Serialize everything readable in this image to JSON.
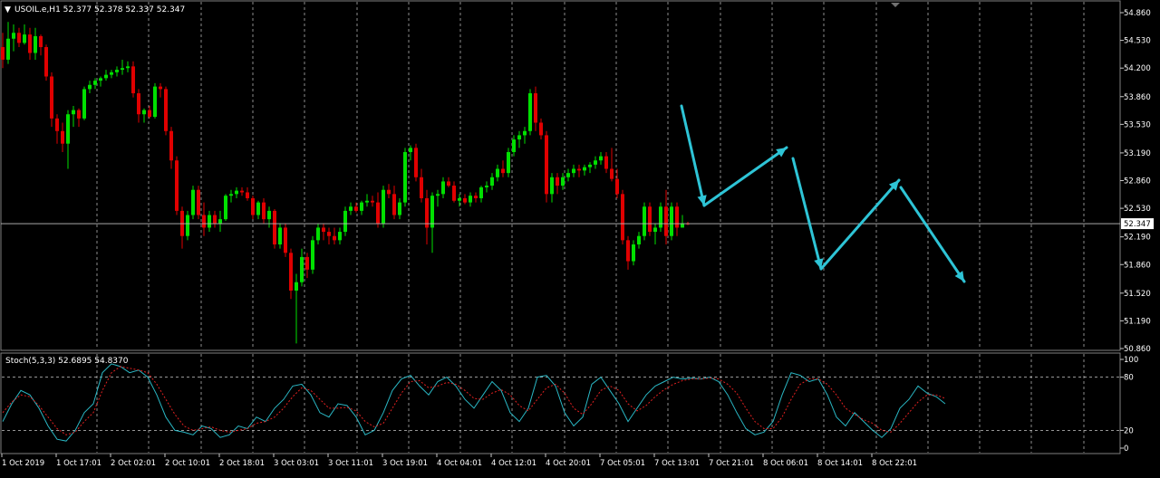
{
  "window": {
    "symbol_line": "USOIL.e,H1  52.377 52.378 52.337 52.347",
    "menu_marker": "▼"
  },
  "price_panel": {
    "current_price_label": "52.347",
    "price_ticks": [
      "54.860",
      "54.530",
      "54.200",
      "53.860",
      "53.530",
      "53.190",
      "52.860",
      "52.530",
      "52.190",
      "51.860",
      "51.520",
      "51.190",
      "50.860"
    ]
  },
  "stoch_panel": {
    "label": "Stoch(5,3,3) 52.6895 54.8370",
    "level_ticks": [
      "100",
      "80",
      "20",
      "0"
    ]
  },
  "time_axis": {
    "labels": [
      "1 Oct 2019",
      "1 Oct 17:01",
      "2 Oct 02:01",
      "2 Oct 10:01",
      "2 Oct 18:01",
      "3 Oct 03:01",
      "3 Oct 11:01",
      "3 Oct 19:01",
      "4 Oct 04:01",
      "4 Oct 12:01",
      "4 Oct 20:01",
      "7 Oct 05:01",
      "7 Oct 13:01",
      "7 Oct 21:01",
      "8 Oct 06:01",
      "8 Oct 14:01",
      "8 Oct 22:01"
    ]
  },
  "colors": {
    "background": "#000000",
    "bull_candle": "#00e000",
    "bear_candle": "#e00000",
    "grid": "#c8c8c8",
    "price_line": "#c0c0c0",
    "stoch_main": "#2ab7c4",
    "stoch_signal": "#e02020",
    "annotation_arrow": "#2ec4d6",
    "axis_text": "#ffffff"
  },
  "chart_data": [
    {
      "type": "candlestick",
      "symbol": "USOIL.e",
      "timeframe": "H1",
      "ylim": [
        50.86,
        54.86
      ],
      "grid": true,
      "ohlc": [
        [
          54.45,
          54.62,
          54.2,
          54.3
        ],
        [
          54.3,
          54.75,
          54.25,
          54.55
        ],
        [
          54.55,
          54.72,
          54.4,
          54.62
        ],
        [
          54.62,
          54.68,
          54.45,
          54.5
        ],
        [
          54.5,
          54.72,
          54.48,
          54.6
        ],
        [
          54.6,
          54.68,
          54.3,
          54.38
        ],
        [
          54.38,
          54.68,
          54.3,
          54.58
        ],
        [
          54.58,
          54.6,
          54.35,
          54.45
        ],
        [
          54.45,
          54.48,
          54.05,
          54.1
        ],
        [
          54.1,
          54.15,
          53.5,
          53.6
        ],
        [
          53.6,
          53.65,
          53.3,
          53.45
        ],
        [
          53.45,
          53.55,
          53.2,
          53.3
        ],
        [
          53.3,
          53.7,
          53.0,
          53.65
        ],
        [
          53.65,
          53.75,
          53.5,
          53.7
        ],
        [
          53.7,
          53.72,
          53.5,
          53.6
        ],
        [
          53.6,
          53.98,
          53.58,
          53.95
        ],
        [
          53.95,
          54.05,
          53.9,
          54.0
        ],
        [
          54.0,
          54.08,
          53.95,
          54.05
        ],
        [
          54.05,
          54.1,
          53.98,
          54.08
        ],
        [
          54.08,
          54.18,
          54.05,
          54.12
        ],
        [
          54.12,
          54.18,
          54.08,
          54.15
        ],
        [
          54.15,
          54.22,
          54.1,
          54.18
        ],
        [
          54.18,
          54.3,
          54.12,
          54.2
        ],
        [
          54.2,
          54.28,
          54.15,
          54.22
        ],
        [
          54.22,
          54.28,
          53.85,
          53.9
        ],
        [
          53.9,
          53.95,
          53.55,
          53.65
        ],
        [
          53.65,
          53.72,
          53.55,
          53.7
        ],
        [
          53.7,
          53.75,
          53.6,
          53.62
        ],
        [
          53.62,
          54.02,
          53.6,
          53.98
        ],
        [
          53.98,
          54.02,
          53.85,
          53.95
        ],
        [
          53.95,
          53.98,
          53.4,
          53.45
        ],
        [
          53.45,
          53.5,
          53.0,
          53.1
        ],
        [
          53.1,
          53.15,
          52.45,
          52.5
        ],
        [
          52.5,
          52.55,
          52.05,
          52.2
        ],
        [
          52.2,
          52.5,
          52.15,
          52.45
        ],
        [
          52.45,
          52.8,
          52.4,
          52.75
        ],
        [
          52.75,
          52.8,
          52.4,
          52.45
        ],
        [
          52.45,
          52.6,
          52.2,
          52.3
        ],
        [
          52.3,
          52.5,
          52.25,
          52.45
        ],
        [
          52.45,
          52.5,
          52.3,
          52.35
        ],
        [
          52.35,
          52.5,
          52.25,
          52.4
        ],
        [
          52.4,
          52.7,
          52.38,
          52.68
        ],
        [
          52.68,
          52.75,
          52.6,
          52.7
        ],
        [
          52.7,
          52.78,
          52.65,
          52.74
        ],
        [
          52.74,
          52.78,
          52.68,
          52.72
        ],
        [
          52.72,
          52.78,
          52.62,
          52.65
        ],
        [
          52.65,
          52.68,
          52.4,
          52.45
        ],
        [
          52.45,
          52.62,
          52.4,
          52.6
        ],
        [
          52.6,
          52.65,
          52.35,
          52.4
        ],
        [
          52.4,
          52.55,
          52.3,
          52.5
        ],
        [
          52.5,
          52.52,
          52.05,
          52.1
        ],
        [
          52.1,
          52.35,
          52.05,
          52.3
        ],
        [
          52.3,
          52.35,
          51.95,
          52.0
        ],
        [
          52.0,
          52.05,
          51.45,
          51.55
        ],
        [
          51.55,
          51.75,
          50.92,
          51.65
        ],
        [
          51.65,
          52.05,
          51.6,
          51.95
        ],
        [
          51.95,
          52.0,
          51.7,
          51.8
        ],
        [
          51.8,
          52.2,
          51.75,
          52.15
        ],
        [
          52.15,
          52.35,
          52.1,
          52.3
        ],
        [
          52.3,
          52.35,
          52.15,
          52.25
        ],
        [
          52.25,
          52.3,
          52.1,
          52.2
        ],
        [
          52.2,
          52.3,
          52.1,
          52.15
        ],
        [
          52.15,
          52.3,
          52.1,
          52.25
        ],
        [
          52.25,
          52.55,
          52.2,
          52.5
        ],
        [
          52.5,
          52.6,
          52.45,
          52.55
        ],
        [
          52.55,
          52.6,
          52.48,
          52.5
        ],
        [
          52.5,
          52.62,
          52.45,
          52.6
        ],
        [
          52.6,
          52.7,
          52.55,
          52.62
        ],
        [
          52.62,
          52.68,
          52.55,
          52.6
        ],
        [
          52.6,
          52.72,
          52.3,
          52.35
        ],
        [
          52.35,
          52.8,
          52.3,
          52.75
        ],
        [
          52.75,
          52.82,
          52.65,
          52.7
        ],
        [
          52.7,
          52.8,
          52.4,
          52.45
        ],
        [
          52.45,
          52.65,
          52.4,
          52.6
        ],
        [
          52.6,
          53.25,
          52.55,
          53.2
        ],
        [
          53.2,
          53.28,
          53.1,
          53.25
        ],
        [
          53.25,
          53.3,
          52.85,
          52.9
        ],
        [
          52.9,
          53.0,
          52.6,
          52.65
        ],
        [
          52.65,
          52.75,
          52.1,
          52.3
        ],
        [
          52.3,
          52.72,
          52.0,
          52.68
        ],
        [
          52.68,
          52.75,
          52.55,
          52.7
        ],
        [
          52.7,
          52.9,
          52.65,
          52.85
        ],
        [
          52.85,
          52.9,
          52.78,
          52.8
        ],
        [
          52.8,
          52.85,
          52.6,
          52.62
        ],
        [
          52.62,
          52.7,
          52.55,
          52.65
        ],
        [
          52.65,
          52.7,
          52.58,
          52.6
        ],
        [
          52.6,
          52.72,
          52.55,
          52.68
        ],
        [
          52.68,
          52.72,
          52.6,
          52.65
        ],
        [
          52.65,
          52.8,
          52.6,
          52.78
        ],
        [
          52.78,
          52.85,
          52.72,
          52.8
        ],
        [
          52.8,
          52.95,
          52.75,
          52.9
        ],
        [
          52.9,
          53.05,
          52.85,
          53.0
        ],
        [
          53.0,
          53.1,
          52.9,
          52.95
        ],
        [
          52.95,
          53.25,
          52.9,
          53.2
        ],
        [
          53.2,
          53.4,
          53.15,
          53.35
        ],
        [
          53.35,
          53.45,
          53.25,
          53.4
        ],
        [
          53.4,
          53.5,
          53.3,
          53.45
        ],
        [
          53.45,
          53.95,
          53.4,
          53.9
        ],
        [
          53.9,
          53.98,
          53.45,
          53.55
        ],
        [
          53.55,
          53.6,
          53.35,
          53.4
        ],
        [
          53.4,
          53.45,
          52.6,
          52.7
        ],
        [
          52.7,
          52.95,
          52.6,
          52.9
        ],
        [
          52.9,
          52.95,
          52.7,
          52.8
        ],
        [
          52.8,
          52.95,
          52.75,
          52.9
        ],
        [
          52.9,
          53.0,
          52.85,
          52.95
        ],
        [
          52.95,
          53.05,
          52.9,
          53.0
        ],
        [
          53.0,
          53.05,
          52.9,
          52.98
        ],
        [
          52.98,
          53.05,
          52.92,
          53.02
        ],
        [
          53.02,
          53.08,
          52.95,
          53.05
        ],
        [
          53.05,
          53.15,
          53.0,
          53.1
        ],
        [
          53.1,
          53.2,
          53.05,
          53.15
        ],
        [
          53.15,
          53.2,
          52.95,
          53.0
        ],
        [
          53.0,
          53.25,
          52.85,
          52.88
        ],
        [
          52.88,
          53.0,
          52.65,
          52.7
        ],
        [
          52.7,
          52.75,
          52.1,
          52.15
        ],
        [
          52.15,
          52.2,
          51.8,
          51.9
        ],
        [
          51.9,
          52.15,
          51.85,
          52.1
        ],
        [
          52.1,
          52.25,
          52.05,
          52.2
        ],
        [
          52.2,
          52.6,
          52.15,
          52.55
        ],
        [
          52.55,
          52.6,
          52.2,
          52.25
        ],
        [
          52.25,
          52.35,
          52.1,
          52.3
        ],
        [
          52.3,
          52.6,
          52.25,
          52.55
        ],
        [
          52.55,
          52.75,
          52.1,
          52.2
        ],
        [
          52.2,
          52.6,
          52.15,
          52.55
        ],
        [
          52.55,
          52.6,
          52.2,
          52.3
        ],
        [
          52.3,
          52.45,
          52.3,
          52.35
        ],
        [
          52.35,
          52.37,
          52.33,
          52.347
        ]
      ],
      "last_price": 52.347
    },
    {
      "type": "line",
      "title": "Stoch(5,3,3) 52.6895 54.8370",
      "ylim": [
        0,
        100
      ],
      "levels": [
        20,
        80
      ],
      "series": [
        {
          "values": [
            30,
            50,
            65,
            60,
            45,
            25,
            10,
            8,
            20,
            40,
            50,
            85,
            95,
            92,
            85,
            88,
            80,
            60,
            35,
            20,
            18,
            15,
            25,
            22,
            12,
            15,
            25,
            22,
            35,
            30,
            45,
            55,
            70,
            72,
            60,
            40,
            35,
            50,
            48,
            35,
            15,
            20,
            40,
            65,
            78,
            82,
            70,
            60,
            75,
            80,
            70,
            55,
            45,
            60,
            75,
            65,
            40,
            30,
            45,
            80,
            82,
            70,
            40,
            25,
            35,
            72,
            80,
            65,
            50,
            30,
            45,
            60,
            70,
            75,
            80,
            78,
            79,
            78,
            80,
            75,
            60,
            40,
            22,
            15,
            18,
            30,
            60,
            85,
            82,
            75,
            78,
            60,
            35,
            25,
            40,
            30,
            20,
            12,
            22,
            45,
            55,
            70,
            62,
            58,
            50
          ]
        },
        {
          "values": [
            40,
            52,
            60,
            58,
            48,
            35,
            22,
            15,
            18,
            30,
            40,
            65,
            85,
            92,
            90,
            88,
            85,
            72,
            55,
            38,
            25,
            20,
            22,
            24,
            20,
            18,
            20,
            22,
            28,
            30,
            35,
            45,
            58,
            68,
            65,
            55,
            45,
            45,
            46,
            42,
            30,
            24,
            28,
            45,
            62,
            75,
            76,
            68,
            70,
            74,
            72,
            65,
            56,
            55,
            62,
            66,
            60,
            48,
            42,
            55,
            68,
            72,
            62,
            45,
            38,
            50,
            65,
            70,
            65,
            50,
            42,
            48,
            58,
            66,
            72,
            76,
            78,
            78,
            79,
            78,
            72,
            62,
            45,
            30,
            22,
            22,
            35,
            55,
            72,
            78,
            78,
            72,
            60,
            45,
            38,
            32,
            28,
            20,
            18,
            28,
            40,
            52,
            60,
            60,
            56
          ]
        }
      ]
    }
  ]
}
